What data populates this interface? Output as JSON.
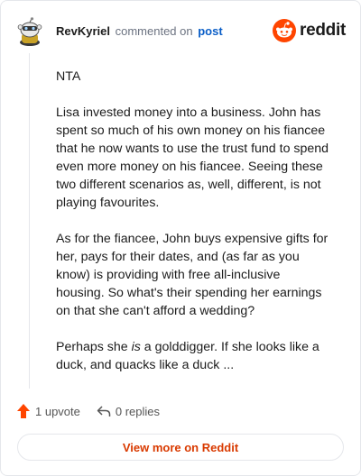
{
  "comment": {
    "author": "RevKyriel",
    "action_text": "commented on",
    "post_link": "post",
    "paragraphs": [
      "NTA",
      "Lisa invested money into a business. John has spent so much of his own money on his fiancee that he now wants to use the trust fund to spend even more money on his fiancee. Seeing these two different scenarios as, well, different, is not playing favourites.",
      "As for the fiancee, John buys expensive gifts for her, pays for their dates, and (as far as you know) is providing with free all-inclusive housing. So what's their spending her earnings on that she can't afford a wedding?"
    ],
    "last_paragraph": {
      "before": "Perhaps she ",
      "emphasis": "is",
      "after": " a golddigger. If she looks like a duck, and quacks like a duck ..."
    }
  },
  "brand": {
    "wordmark": "reddit",
    "color": "#ff4500"
  },
  "stats": {
    "upvotes": "1 upvote",
    "replies": "0 replies"
  },
  "footer": {
    "view_more": "View more on Reddit"
  }
}
